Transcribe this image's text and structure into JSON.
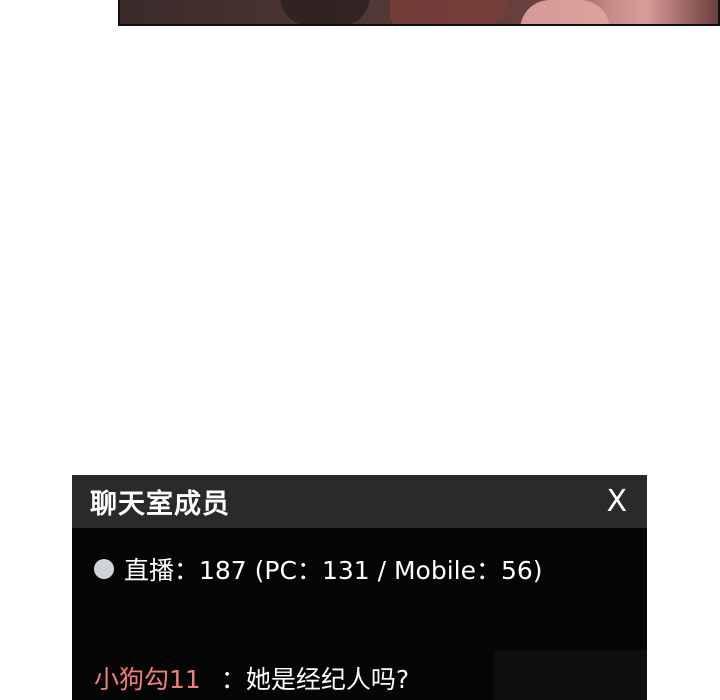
{
  "chat": {
    "title": "聊天室成员",
    "close_label": "X",
    "members_text": "直播：187 (PC：131 / Mobile：56)",
    "message": {
      "user": "小狗勾11",
      "separator": "：",
      "text": "她是经纪人吗?"
    }
  },
  "colors": {
    "header_bg": "#2a2a2a",
    "body_bg": "#050505",
    "username": "#f07f7a",
    "status_dot": "#cfd3d6"
  },
  "icons": {
    "status_dot": "online-dot-icon"
  }
}
